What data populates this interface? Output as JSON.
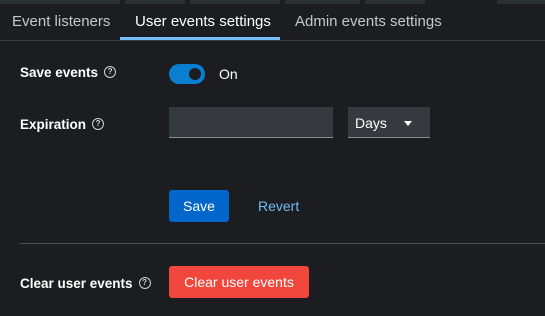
{
  "tabs": [
    {
      "label": "Event listeners",
      "active": false
    },
    {
      "label": "User events settings",
      "active": true
    },
    {
      "label": "Admin events settings",
      "active": false
    }
  ],
  "form": {
    "save_events_label": "Save events",
    "save_events_state": "On",
    "save_events_enabled": true,
    "expiration_label": "Expiration",
    "expiration_value": "",
    "expiration_unit": "Days",
    "save_label": "Save",
    "revert_label": "Revert"
  },
  "clear": {
    "label": "Clear user events",
    "button_label": "Clear user events"
  },
  "icons": {
    "help": "help-icon",
    "dropdown": "caret-down-icon"
  },
  "colors": {
    "background": "#1b1d21",
    "accent": "#73bcf7",
    "primary_button": "#0066cc",
    "toggle_on": "#0a7fd1",
    "danger_button": "#f0463c"
  }
}
